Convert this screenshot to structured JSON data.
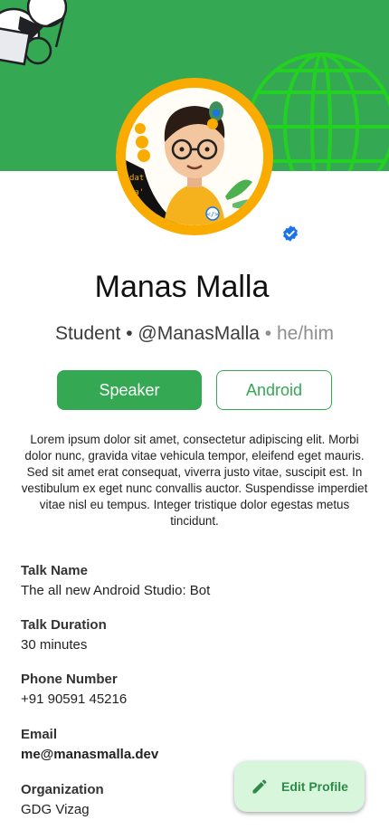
{
  "profile": {
    "name": "Manas Malla",
    "role": "Student",
    "separator": "•",
    "handle": "@ManasMalla",
    "pronouns": "• he/him",
    "tags": [
      "Speaker",
      "Android"
    ],
    "bio": "Lorem ipsum dolor sit amet, consectetur adipiscing elit. Morbi dolor nunc, gravida vitae vehicula tempor, eleifend eget mauris. Sed sit amet erat consequat, viverra justo vitae, suscipit est. In vestibulum ex eget nunc convallis auctor. Suspendisse imperdiet vitae nisl eu tempus. Integer tristique dolor egestas metus tincidunt."
  },
  "details": [
    {
      "label": "Talk Name",
      "value": "The all new Android Studio: Bot"
    },
    {
      "label": "Talk Duration",
      "value": "30 minutes"
    },
    {
      "label": "Phone Number",
      "value": "+91 90591 45216"
    },
    {
      "label": "Email",
      "value": "me@manasmalla.dev"
    },
    {
      "label": "Organization",
      "value": "GDG Vizag"
    }
  ],
  "fab": {
    "label": "Edit Profile",
    "icon": "pencil-icon"
  },
  "colors": {
    "brand_green": "#34a853",
    "ring_yellow": "#f9ab00",
    "verified_blue": "#1a73e8",
    "fab_bg": "#d8f6dc"
  }
}
